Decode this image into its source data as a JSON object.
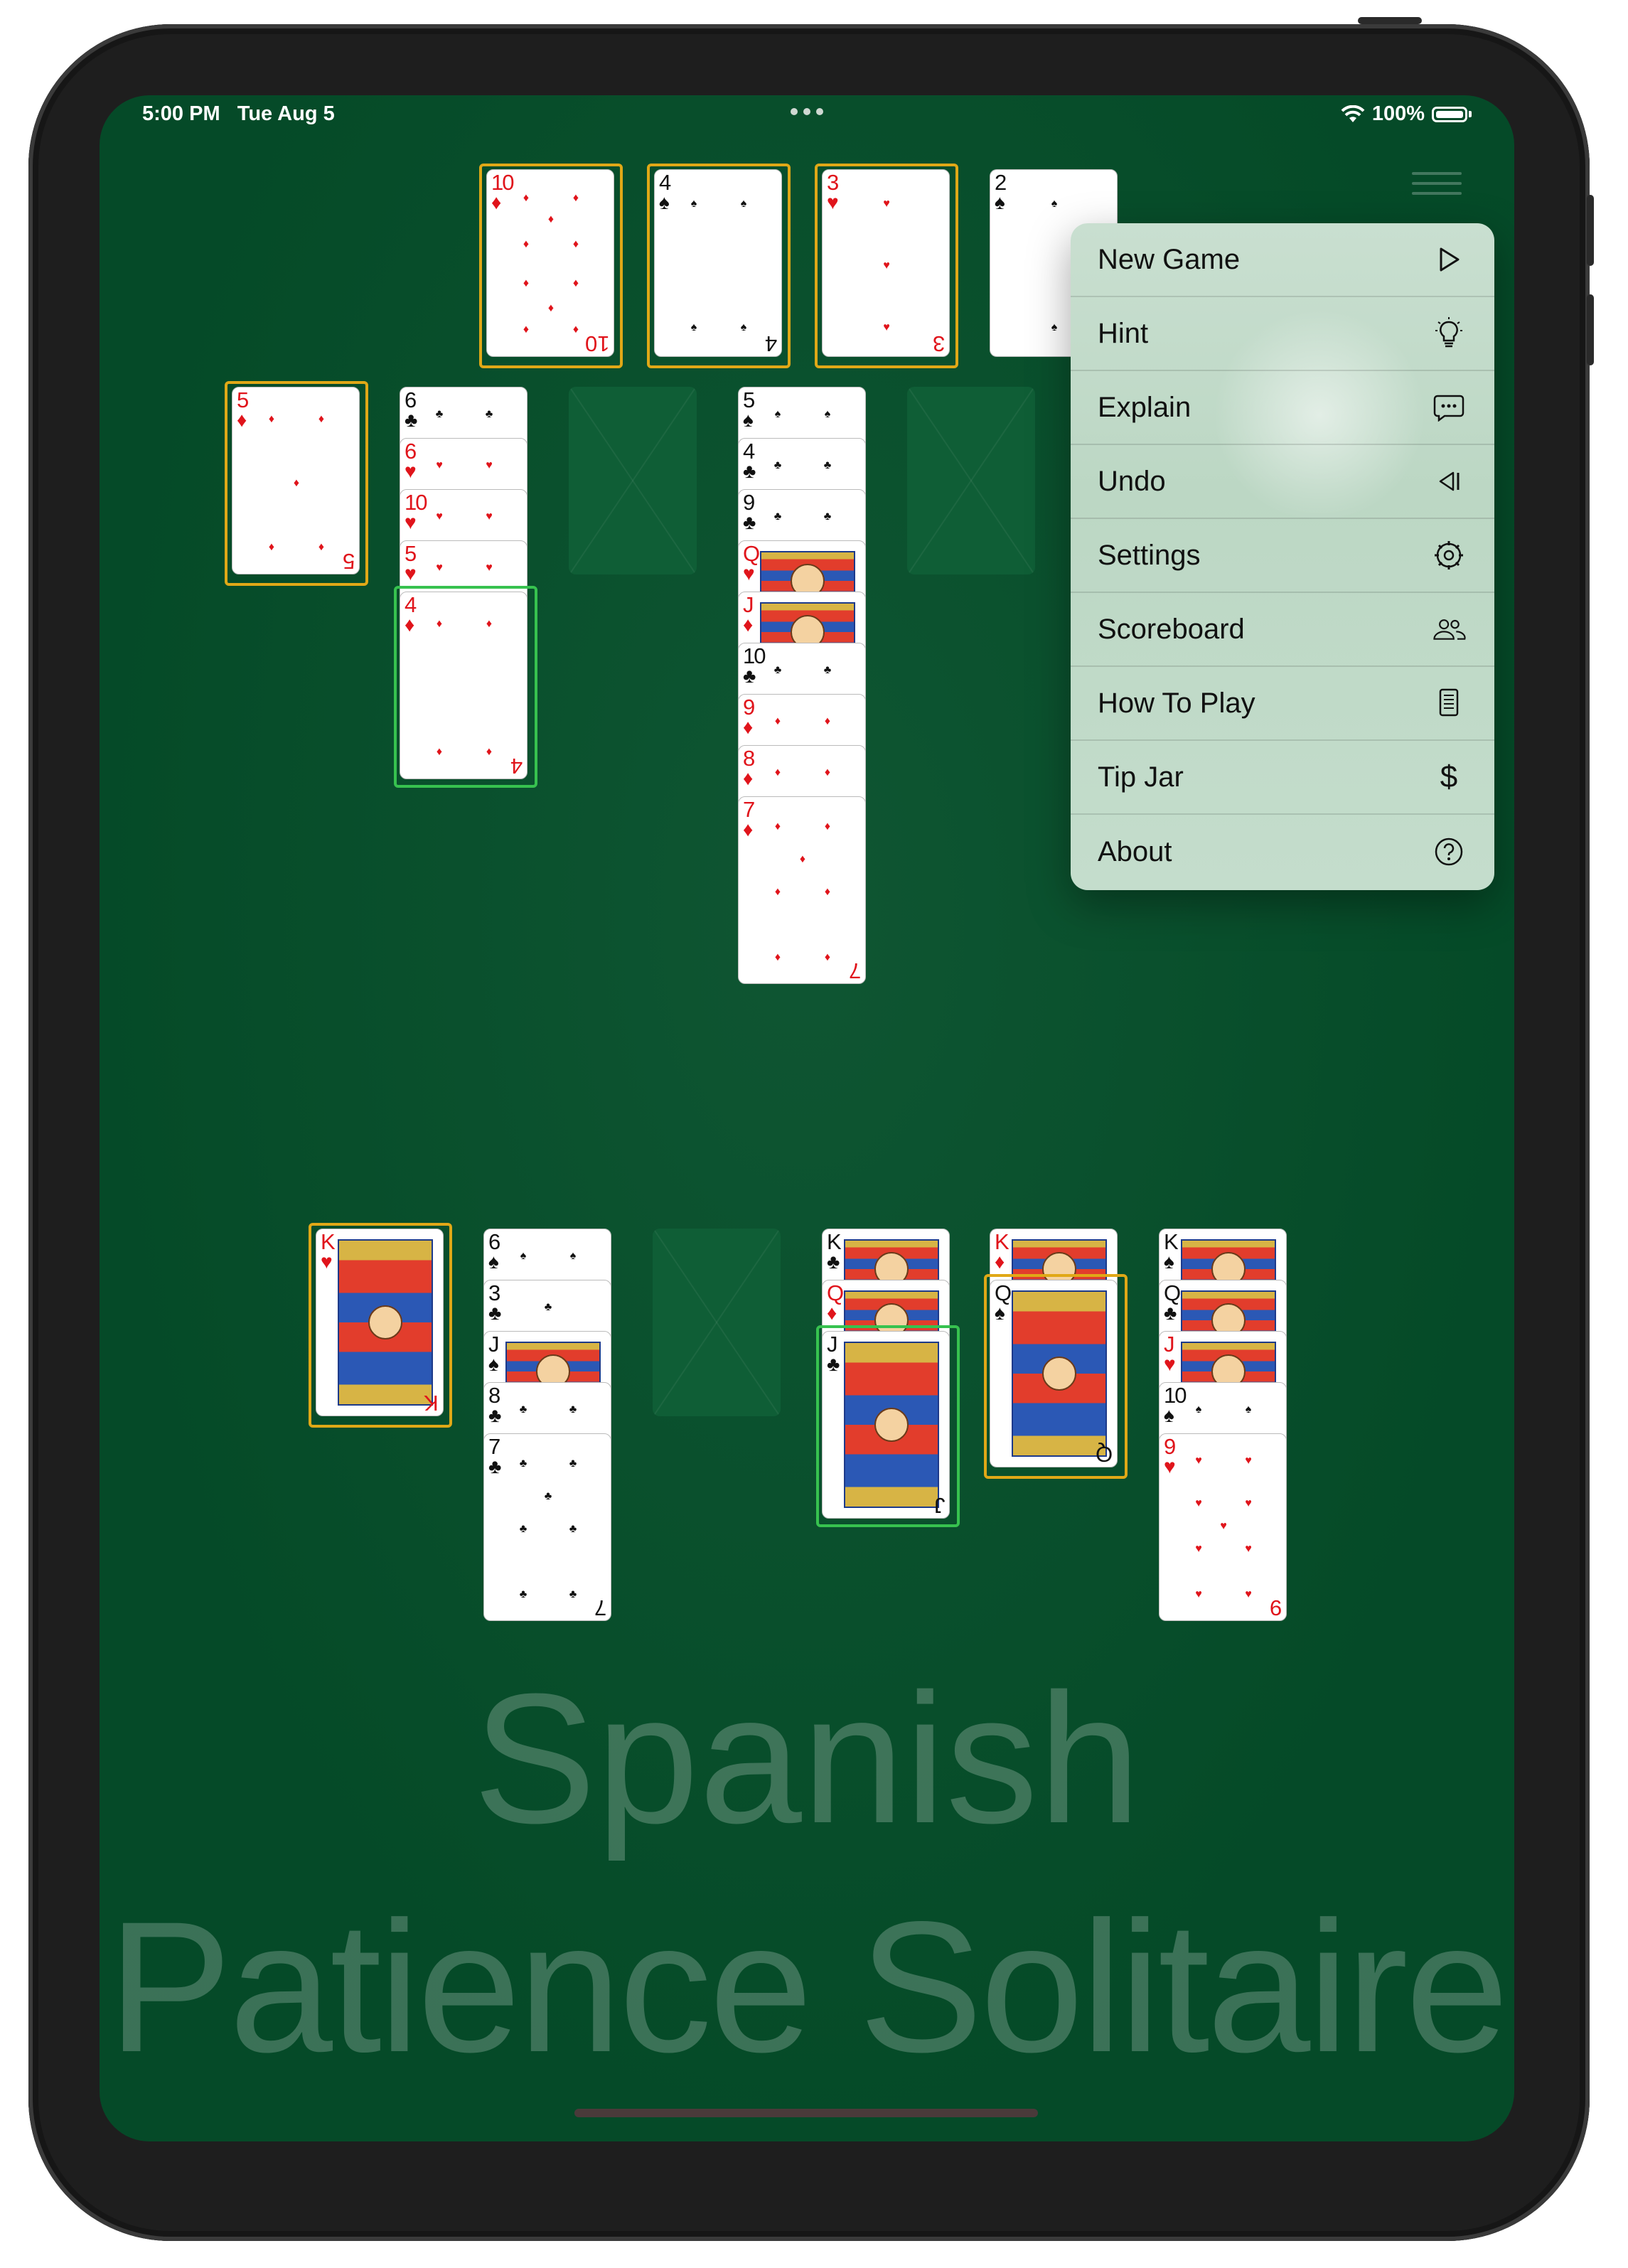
{
  "status_bar": {
    "time": "5:00 PM",
    "date": "Tue Aug 5",
    "battery": "100%"
  },
  "menu": {
    "items": [
      {
        "label": "New Game",
        "icon": "play-icon"
      },
      {
        "label": "Hint",
        "icon": "lightbulb-icon"
      },
      {
        "label": "Explain",
        "icon": "speech-bubble-icon"
      },
      {
        "label": "Undo",
        "icon": "undo-icon"
      },
      {
        "label": "Settings",
        "icon": "gear-icon"
      },
      {
        "label": "Scoreboard",
        "icon": "people-icon"
      },
      {
        "label": "How To Play",
        "icon": "book-icon"
      },
      {
        "label": "Tip Jar",
        "icon": "dollar-icon"
      },
      {
        "label": "About",
        "icon": "help-icon"
      }
    ]
  },
  "cards": {
    "top_10d": {
      "rank": "10",
      "suit": "♦"
    },
    "top_4s": {
      "rank": "4",
      "suit": "♠"
    },
    "top_3h": {
      "rank": "3",
      "suit": "♥"
    },
    "top_2s": {
      "rank": "2",
      "suit": "♠"
    },
    "c1_5d": {
      "rank": "5",
      "suit": "♦"
    },
    "c2_6c": {
      "rank": "6",
      "suit": "♣"
    },
    "c2_6h": {
      "rank": "6",
      "suit": "♥"
    },
    "c2_10h": {
      "rank": "10",
      "suit": "♥"
    },
    "c2_5h": {
      "rank": "5",
      "suit": "♥"
    },
    "c2_4d": {
      "rank": "4",
      "suit": "♦"
    },
    "c4_5s": {
      "rank": "5",
      "suit": "♠"
    },
    "c4_4c": {
      "rank": "4",
      "suit": "♣"
    },
    "c4_9c": {
      "rank": "9",
      "suit": "♣"
    },
    "c4_qh": {
      "rank": "Q",
      "suit": "♥"
    },
    "c4_jd": {
      "rank": "J",
      "suit": "♦"
    },
    "c4_10c": {
      "rank": "10",
      "suit": "♣"
    },
    "c4_9d": {
      "rank": "9",
      "suit": "♦"
    },
    "c4_8d": {
      "rank": "8",
      "suit": "♦"
    },
    "c4_7d": {
      "rank": "7",
      "suit": "♦"
    },
    "b1_kh": {
      "rank": "K",
      "suit": "♥"
    },
    "b2_6s": {
      "rank": "6",
      "suit": "♠"
    },
    "b2_3c": {
      "rank": "3",
      "suit": "♣"
    },
    "b2_js": {
      "rank": "J",
      "suit": "♠"
    },
    "b2_8c": {
      "rank": "8",
      "suit": "♣"
    },
    "b2_7c": {
      "rank": "7",
      "suit": "♣"
    },
    "b4_kc": {
      "rank": "K",
      "suit": "♣"
    },
    "b4_qd": {
      "rank": "Q",
      "suit": "♦"
    },
    "b4_jc": {
      "rank": "J",
      "suit": "♣"
    },
    "b5_kd": {
      "rank": "K",
      "suit": "♦"
    },
    "b5_qs": {
      "rank": "Q",
      "suit": "♠"
    },
    "b6_ks": {
      "rank": "K",
      "suit": "♠"
    },
    "b6_qc": {
      "rank": "Q",
      "suit": "♣"
    },
    "b6_jh": {
      "rank": "J",
      "suit": "♥"
    },
    "b6_10s": {
      "rank": "10",
      "suit": "♠"
    },
    "b6_9h": {
      "rank": "9",
      "suit": "♥"
    }
  },
  "title": {
    "line1": "Spanish",
    "line2": "Patience Solitaire"
  }
}
